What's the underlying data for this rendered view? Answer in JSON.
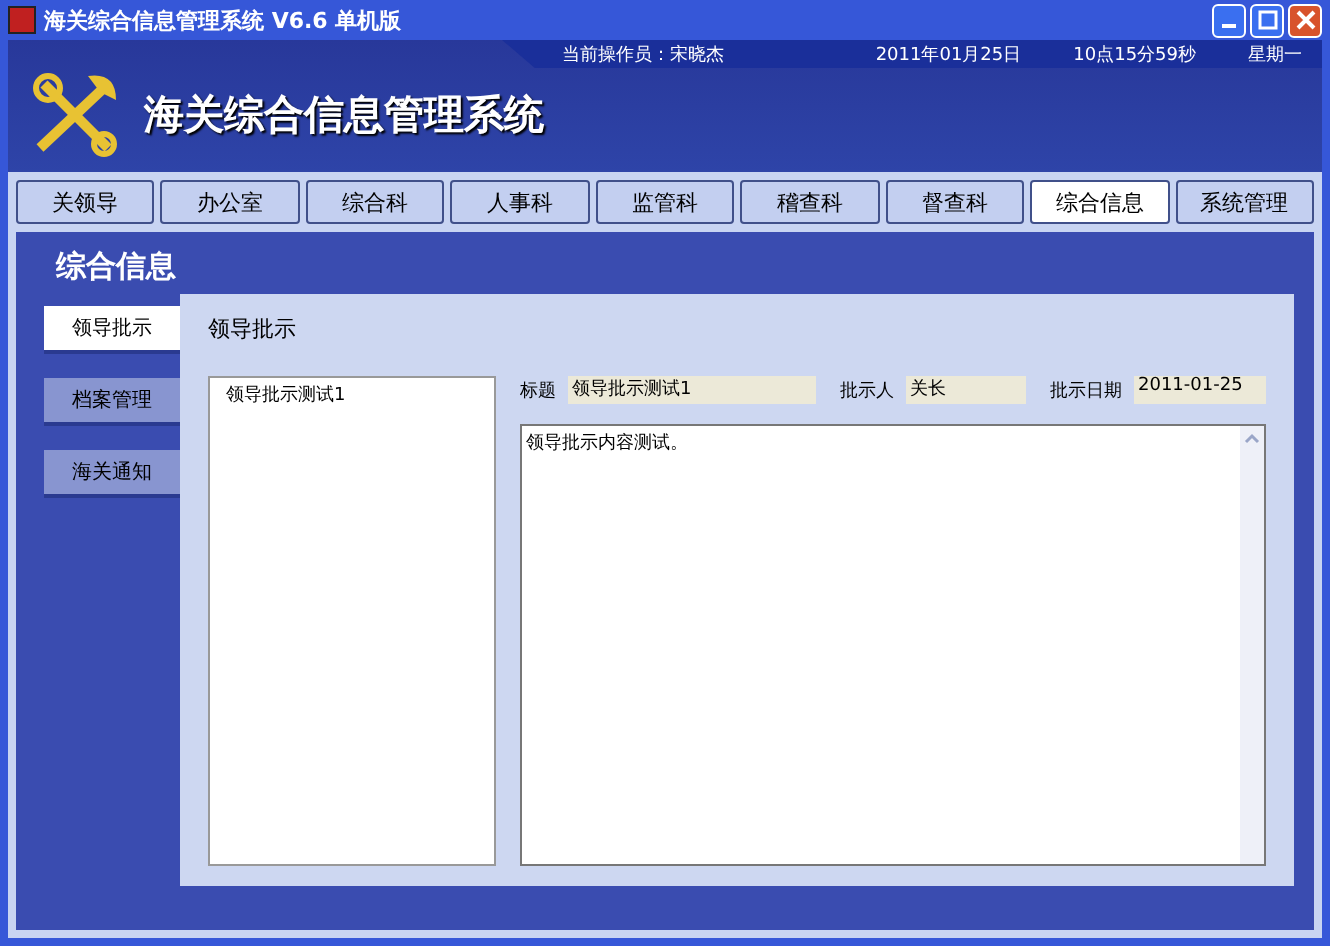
{
  "window": {
    "title": "海关综合信息管理系统 V6.6  单机版"
  },
  "header": {
    "operator": "当前操作员：宋晓杰",
    "date": "2011年01月25日",
    "time": "10点15分59秒",
    "weekday": "星期一",
    "app_name": "海关综合信息管理系统"
  },
  "tabs": [
    {
      "label": "关领导",
      "selected": false
    },
    {
      "label": "办公室",
      "selected": false
    },
    {
      "label": "综合科",
      "selected": false
    },
    {
      "label": "人事科",
      "selected": false
    },
    {
      "label": "监管科",
      "selected": false
    },
    {
      "label": "稽查科",
      "selected": false
    },
    {
      "label": "督查科",
      "selected": false
    },
    {
      "label": "综合信息",
      "selected": true
    },
    {
      "label": "系统管理",
      "selected": false
    }
  ],
  "section_title": "综合信息",
  "sidebar": {
    "items": [
      {
        "label": "领导批示",
        "selected": true
      },
      {
        "label": "档案管理",
        "selected": false
      },
      {
        "label": "海关通知",
        "selected": false
      }
    ]
  },
  "content": {
    "heading": "领导批示",
    "list": [
      "领导批示测试1"
    ],
    "fields": [
      {
        "label": "标题",
        "value": "领导批示测试1"
      },
      {
        "label": "批示人",
        "value": "关长"
      },
      {
        "label": "批示日期",
        "value": "2011-01-25"
      }
    ],
    "body": "领导批示内容测试。"
  }
}
